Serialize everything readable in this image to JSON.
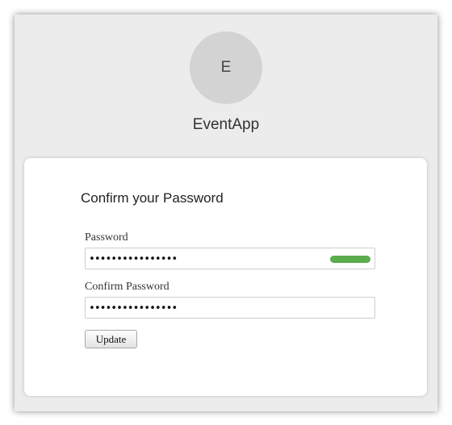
{
  "app": {
    "avatar_letter": "E",
    "name": "EventApp"
  },
  "form": {
    "title": "Confirm your Password",
    "password_label": "Password",
    "password_value": "••••••••••••••••",
    "password_strength": "strong",
    "confirm_label": "Confirm Password",
    "confirm_value": "••••••••••••••••",
    "submit_label": "Update"
  },
  "colors": {
    "strength_bar": "#5aac4c",
    "background": "#ececec",
    "avatar": "#d3d3d3"
  }
}
